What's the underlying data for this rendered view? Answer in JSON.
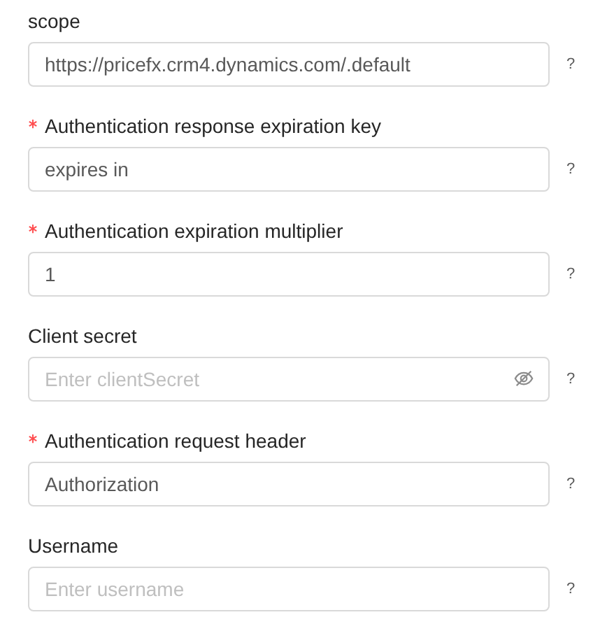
{
  "fields": [
    {
      "label": "scope",
      "required": false,
      "kind": "text",
      "value": "https://pricefx.crm4.dynamics.com/.default",
      "help": "?"
    },
    {
      "label": "Authentication response expiration key",
      "required": true,
      "kind": "text",
      "value": "expires in",
      "help": "?"
    },
    {
      "label": "Authentication expiration multiplier",
      "required": true,
      "kind": "text",
      "value": "1",
      "help": "?"
    },
    {
      "label": "Client secret",
      "required": false,
      "kind": "password",
      "placeholder": "Enter clientSecret",
      "help": "?"
    },
    {
      "label": "Authentication request header",
      "required": true,
      "kind": "text",
      "value": "Authorization",
      "help": "?"
    },
    {
      "label": "Username",
      "required": false,
      "kind": "text",
      "placeholder": "Enter username",
      "help": "?"
    }
  ]
}
